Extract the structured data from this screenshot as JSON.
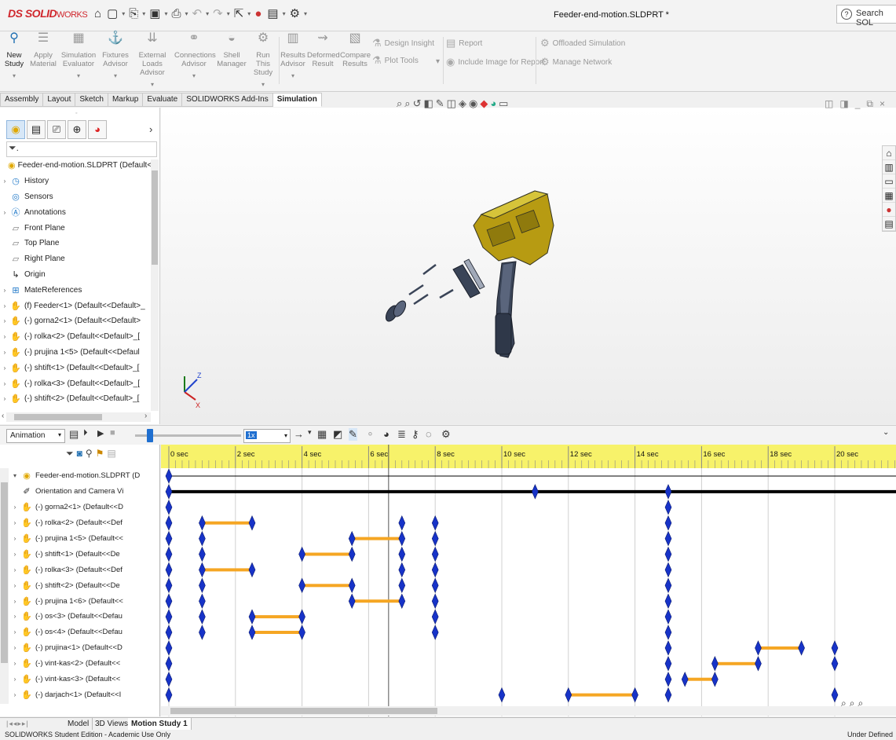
{
  "app": {
    "logo_prefix": "DS",
    "logo_brand": "SOLID",
    "logo_suffix": "WORKS",
    "document_title": "Feeder-end-motion.SLDPRT *",
    "search_placeholder": "Search SOL"
  },
  "ribbon": {
    "buttons": [
      {
        "label": "New Study",
        "icon": "new-study-icon",
        "active": true
      },
      {
        "label": "Apply Material",
        "icon": "apply-material-icon"
      },
      {
        "label": "Simulation Evaluator",
        "icon": "evaluator-icon"
      },
      {
        "label": "Fixtures Advisor",
        "icon": "fixtures-icon"
      },
      {
        "label": "External Loads Advisor",
        "icon": "loads-icon"
      },
      {
        "label": "Connections Advisor",
        "icon": "connections-icon"
      },
      {
        "label": "Shell Manager",
        "icon": "shell-icon"
      },
      {
        "label": "Run This Study",
        "icon": "run-icon"
      },
      {
        "label": "Results Advisor",
        "icon": "results-icon"
      },
      {
        "label": "Deformed Result",
        "icon": "deformed-icon"
      },
      {
        "label": "Compare Results",
        "icon": "compare-icon"
      }
    ],
    "design_insight": "Design Insight",
    "plot_tools": "Plot Tools",
    "report": "Report",
    "include_image": "Include Image for Report",
    "offloaded": "Offloaded Simulation",
    "manage_network": "Manage Network"
  },
  "tabs": [
    "Assembly",
    "Layout",
    "Sketch",
    "Markup",
    "Evaluate",
    "SOLIDWORKS Add-Ins",
    "Simulation"
  ],
  "feature_tree": {
    "root": "Feeder-end-motion.SLDPRT  (Default<",
    "items": [
      {
        "label": "History",
        "expand": "›",
        "icon": "history-icon"
      },
      {
        "label": "Sensors",
        "expand": "",
        "icon": "sensor-icon"
      },
      {
        "label": "Annotations",
        "expand": "›",
        "icon": "annotations-icon"
      },
      {
        "label": "Front Plane",
        "expand": "",
        "icon": "plane-icon"
      },
      {
        "label": "Top Plane",
        "expand": "",
        "icon": "plane-icon"
      },
      {
        "label": "Right Plane",
        "expand": "",
        "icon": "plane-icon"
      },
      {
        "label": "Origin",
        "expand": "",
        "icon": "origin-icon"
      },
      {
        "label": "MateReferences",
        "expand": "›",
        "icon": "mate-icon"
      },
      {
        "label": "(f) Feeder<1> (Default<<Default>_",
        "expand": "›",
        "icon": "part-icon"
      },
      {
        "label": "(-) gorna2<1> (Default<<Default>",
        "expand": "›",
        "icon": "part-icon"
      },
      {
        "label": "(-) rolka<2> (Default<<Default>_[",
        "expand": "›",
        "icon": "part-icon"
      },
      {
        "label": "(-) prujina 1<5> (Default<<Defaul",
        "expand": "›",
        "icon": "part-icon"
      },
      {
        "label": "(-) shtift<1> (Default<<Default>_[",
        "expand": "›",
        "icon": "part-icon"
      },
      {
        "label": "(-) rolka<3> (Default<<Default>_[",
        "expand": "›",
        "icon": "part-icon"
      },
      {
        "label": "(-) shtift<2> (Default<<Default>_[",
        "expand": "›",
        "icon": "part-icon"
      }
    ]
  },
  "motion": {
    "study_type": "Animation",
    "speed": "1x",
    "root": "Feeder-end-motion.SLDPRT (D",
    "rows": [
      {
        "label": "Orientation and Camera Vi",
        "expand": "",
        "icon": "camera-icon"
      },
      {
        "label": "(-) gorna2<1> (Default<<D",
        "expand": "›",
        "icon": "part-icon"
      },
      {
        "label": "(-) rolka<2> (Default<<Def",
        "expand": "›",
        "icon": "part-icon"
      },
      {
        "label": "(-) prujina 1<5> (Default<<",
        "expand": "›",
        "icon": "part-icon"
      },
      {
        "label": "(-) shtift<1> (Default<<De",
        "expand": "›",
        "icon": "part-icon"
      },
      {
        "label": "(-) rolka<3> (Default<<Def",
        "expand": "›",
        "icon": "part-icon"
      },
      {
        "label": "(-) shtift<2> (Default<<De",
        "expand": "›",
        "icon": "part-icon"
      },
      {
        "label": "(-) prujina 1<6> (Default<<",
        "expand": "›",
        "icon": "part-icon"
      },
      {
        "label": "(-) os<3> (Default<<Defau",
        "expand": "›",
        "icon": "part-icon"
      },
      {
        "label": "(-) os<4> (Default<<Defau",
        "expand": "›",
        "icon": "part-icon"
      },
      {
        "label": "(-) prujina<1> (Default<<D",
        "expand": "›",
        "icon": "part-icon"
      },
      {
        "label": "(-) vint-kas<2> (Default<<",
        "expand": "›",
        "icon": "part-icon"
      },
      {
        "label": "(-) vint-kas<3> (Default<<",
        "expand": "›",
        "icon": "part-icon"
      },
      {
        "label": "(-) darjach<1> (Default<<I",
        "expand": "›",
        "icon": "part-icon"
      }
    ],
    "time_labels": [
      "0 sec",
      "2 sec",
      "4 sec",
      "6 sec",
      "8 sec",
      "10 sec",
      "12 sec",
      "14 sec",
      "16 sec",
      "18 sec",
      "20 sec"
    ],
    "time_max": 22,
    "playhead": 6.6,
    "root_keys": [
      0
    ],
    "camera_keys": [
      0,
      11,
      15
    ],
    "tracks": [
      {
        "keys": [
          0,
          15
        ],
        "bars": []
      },
      {
        "keys": [
          0,
          1,
          2.5,
          7,
          8,
          15
        ],
        "bars": [
          [
            1,
            2.5
          ]
        ]
      },
      {
        "keys": [
          0,
          1,
          5.5,
          7,
          8,
          15
        ],
        "bars": [
          [
            5.5,
            7
          ]
        ]
      },
      {
        "keys": [
          0,
          1,
          4,
          5.5,
          7,
          8,
          15
        ],
        "bars": [
          [
            4,
            5.5
          ]
        ]
      },
      {
        "keys": [
          0,
          1,
          2.5,
          7,
          8,
          15
        ],
        "bars": [
          [
            1,
            2.5
          ]
        ]
      },
      {
        "keys": [
          0,
          1,
          4,
          5.5,
          7,
          8,
          15
        ],
        "bars": [
          [
            4,
            5.5
          ]
        ]
      },
      {
        "keys": [
          0,
          1,
          5.5,
          7,
          8,
          15
        ],
        "bars": [
          [
            5.5,
            7
          ]
        ]
      },
      {
        "keys": [
          0,
          1,
          2.5,
          4,
          8,
          15
        ],
        "bars": [
          [
            2.5,
            4
          ]
        ]
      },
      {
        "keys": [
          0,
          1,
          2.5,
          4,
          8,
          15
        ],
        "bars": [
          [
            2.5,
            4
          ]
        ]
      },
      {
        "keys": [
          0,
          15,
          17.7,
          19,
          20
        ],
        "bars": [
          [
            17.7,
            19
          ]
        ]
      },
      {
        "keys": [
          0,
          15,
          16.4,
          17.7,
          20
        ],
        "bars": [
          [
            16.4,
            17.7
          ]
        ]
      },
      {
        "keys": [
          0,
          15,
          15.5,
          16.4
        ],
        "bars": [
          [
            15.5,
            16.4
          ]
        ]
      },
      {
        "keys": [
          0,
          10,
          12,
          14,
          15,
          20
        ],
        "bars": [
          [
            12,
            14
          ]
        ]
      }
    ],
    "colors": {
      "ruler": "#f7f26a",
      "bar": "#f5a623",
      "key": "#1733c8",
      "line": "#000000"
    }
  },
  "bottom_tabs": [
    "Model",
    "3D Views",
    "Motion Study 1"
  ],
  "status": {
    "left": "SOLIDWORKS Student Edition - Academic Use Only",
    "right": "Under Defined"
  }
}
